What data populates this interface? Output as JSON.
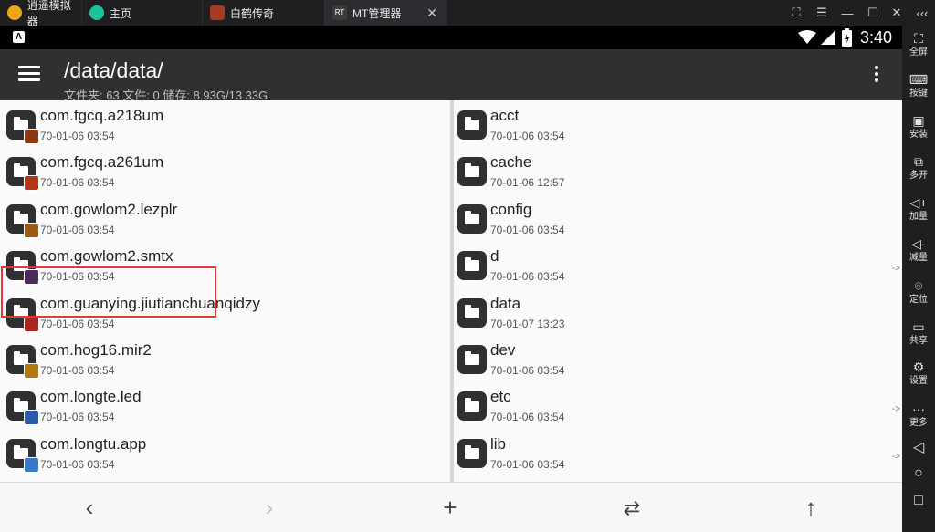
{
  "emulator": {
    "tabs": [
      {
        "label": "逍遥模拟器",
        "color": "#f2a516"
      },
      {
        "label": "主页",
        "color": "#18c29c"
      },
      {
        "label": "白鹤传奇",
        "color": "#a23b1f"
      },
      {
        "label": "MT管理器",
        "color": "#3b3b3b"
      }
    ],
    "tab_icon_mt": "RT",
    "window_controls": [
      "⛶",
      "☰",
      "—",
      "☐",
      "✕",
      "‹‹‹"
    ],
    "sidebar": [
      {
        "icon": "fullscreen-icon",
        "glyph": "⛶",
        "label": "全屏"
      },
      {
        "icon": "keyboard-icon",
        "glyph": "⌨",
        "label": "按键"
      },
      {
        "icon": "apk-install-icon",
        "glyph": "▣",
        "label": "安装"
      },
      {
        "icon": "multi-instance-icon",
        "glyph": "⧉",
        "label": "多开"
      },
      {
        "icon": "volume-up-icon",
        "glyph": "◁+",
        "label": "加量"
      },
      {
        "icon": "volume-down-icon",
        "glyph": "◁-",
        "label": "减量"
      },
      {
        "icon": "location-icon",
        "glyph": "⌾",
        "label": "定位"
      },
      {
        "icon": "share-folder-icon",
        "glyph": "▭",
        "label": "共享"
      },
      {
        "icon": "settings-icon",
        "glyph": "⚙",
        "label": "设置"
      },
      {
        "icon": "more-icon",
        "glyph": "···",
        "label": "更多"
      }
    ],
    "android_nav": [
      "◁",
      "○",
      "□"
    ]
  },
  "statusbar": {
    "notification": "A",
    "battery": "🔋",
    "time": "3:40"
  },
  "appbar": {
    "path": "/data/data/",
    "subtitle": "文件夹: 63  文件: 0  储存: 8.93G/13.33G"
  },
  "left_pane": {
    "items": [
      {
        "name": "com.fgcq.a218um",
        "date": "70-01-06 03:54",
        "badge": "#8a3a12"
      },
      {
        "name": "com.fgcq.a261um",
        "date": "70-01-06 03:54",
        "badge": "#b8321a"
      },
      {
        "name": "com.gowlom2.lezplr",
        "date": "70-01-06 03:54",
        "badge": "#9c5a14"
      },
      {
        "name": "com.gowlom2.smtx",
        "date": "70-01-06 03:54",
        "badge": "#4a2d5c"
      },
      {
        "name": "com.guanying.jiutianchuanqidzy",
        "date": "70-01-06 03:54",
        "badge": "#a8261e"
      },
      {
        "name": "com.hog16.mir2",
        "date": "70-01-06 03:54",
        "badge": "#b07a12"
      },
      {
        "name": "com.longte.led",
        "date": "70-01-06 03:54",
        "badge": "#2a5ca8"
      },
      {
        "name": "com.longtu.app",
        "date": "70-01-06 03:54",
        "badge": "#3a78c8"
      }
    ],
    "selected_index": 2
  },
  "right_pane": {
    "items": [
      {
        "name": "acct",
        "date": "70-01-06 03:54",
        "arrow": ""
      },
      {
        "name": "cache",
        "date": "70-01-06 12:57",
        "arrow": ""
      },
      {
        "name": "config",
        "date": "70-01-06 03:54",
        "arrow": ""
      },
      {
        "name": "d",
        "date": "70-01-06 03:54",
        "arrow": "->"
      },
      {
        "name": "data",
        "date": "70-01-07 13:23",
        "arrow": ""
      },
      {
        "name": "dev",
        "date": "70-01-06 03:54",
        "arrow": ""
      },
      {
        "name": "etc",
        "date": "70-01-06 03:54",
        "arrow": "->"
      },
      {
        "name": "lib",
        "date": "70-01-06 03:54",
        "arrow": "->"
      }
    ]
  },
  "bottombar": {
    "back": "‹",
    "forward": "›",
    "add": "+",
    "swap": "⇄",
    "up": "↑"
  }
}
